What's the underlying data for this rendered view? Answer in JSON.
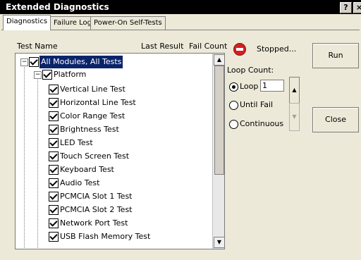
{
  "window": {
    "title": "Extended Diagnostics",
    "help_label": "?",
    "close_label": "×"
  },
  "tabs": [
    {
      "label": "Diagnostics",
      "active": true
    },
    {
      "label": "Failure Log",
      "active": false
    },
    {
      "label": "Power-On Self-Tests",
      "active": false
    }
  ],
  "columns": {
    "test_name": "Test Name",
    "last_result": "Last Result",
    "fail_count": "Fail Count"
  },
  "tree": {
    "root": {
      "label": "All Modules, All Tests",
      "checked": true,
      "expanded": true,
      "selected": true
    },
    "platform": {
      "label": "Platform",
      "checked": true,
      "expanded": true
    },
    "items": [
      {
        "label": "Vertical Line Test",
        "checked": true
      },
      {
        "label": "Horizontal Line Test",
        "checked": true
      },
      {
        "label": "Color Range Test",
        "checked": true
      },
      {
        "label": "Brightness Test",
        "checked": true
      },
      {
        "label": "LED Test",
        "checked": true
      },
      {
        "label": "Touch Screen Test",
        "checked": true
      },
      {
        "label": "Keyboard Test",
        "checked": true
      },
      {
        "label": "Audio Test",
        "checked": true
      },
      {
        "label": "PCMCIA Slot 1 Test",
        "checked": true
      },
      {
        "label": "PCMCIA Slot 2 Test",
        "checked": true
      },
      {
        "label": "Network Port Test",
        "checked": true
      },
      {
        "label": "USB Flash Memory Test",
        "checked": true
      }
    ]
  },
  "status": {
    "text": "Stopped...",
    "icon": "stop-icon",
    "color": "#d42020"
  },
  "loop": {
    "label": "Loop Count:",
    "options": [
      {
        "label": "Loop",
        "selected": true
      },
      {
        "label": "Until Fail",
        "selected": false
      },
      {
        "label": "Continuous",
        "selected": false
      }
    ],
    "count_value": "1"
  },
  "buttons": {
    "run": "Run",
    "close": "Close"
  },
  "colors": {
    "selection": "#0a246a",
    "titlebar": "#000000",
    "face": "#ece9d8"
  }
}
